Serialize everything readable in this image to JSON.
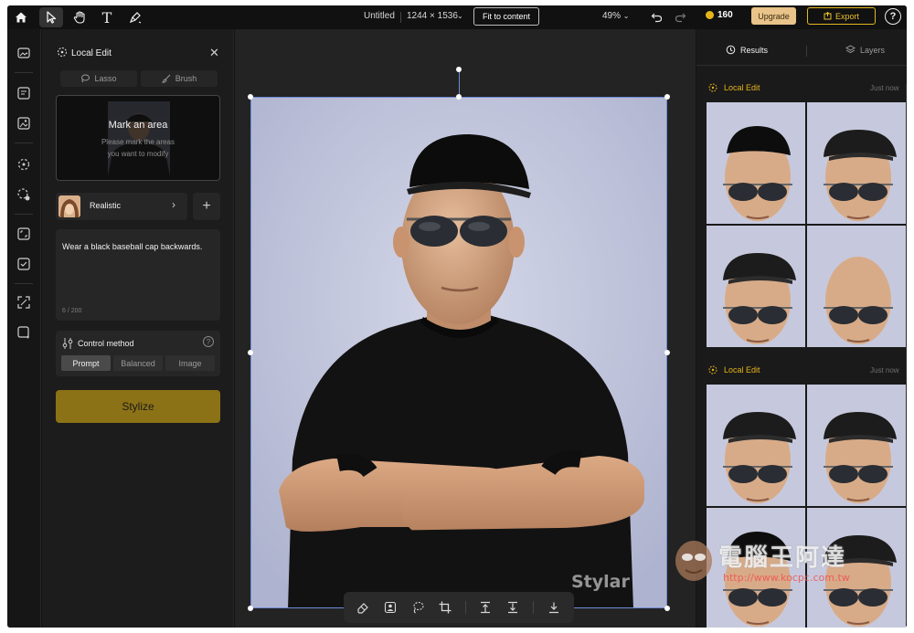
{
  "topbar": {
    "doc_title": "Untitled",
    "doc_size": "1244 × 1536",
    "fit_label": "Fit to content",
    "zoom": "49%",
    "credits": "160",
    "upgrade_label": "Upgrade",
    "export_label": "Export",
    "help_label": "?"
  },
  "panel": {
    "title": "Local Edit",
    "tools": [
      "Lasso",
      "Brush"
    ],
    "mark_title": "Mark an area",
    "mark_sub_1": "Please mark the areas",
    "mark_sub_2": "you want to modify",
    "style_name": "Realistic",
    "prompt_text": "Wear a black baseball cap backwards.",
    "prompt_count": "6 / 200",
    "control_title": "Control method",
    "control_options": [
      "Prompt",
      "Balanced",
      "Image"
    ],
    "control_selected": "Prompt",
    "stylize_label": "Stylize"
  },
  "results": {
    "tabs": [
      "Results",
      "Layers"
    ],
    "groups": [
      {
        "label": "Local Edit",
        "time": "Just now"
      },
      {
        "label": "Local Edit",
        "time": "Just now"
      }
    ]
  },
  "watermarks": {
    "stylar": "Stylar",
    "cn": "電腦王阿達",
    "url": "http://www.kocpc.com.tw"
  },
  "colors": {
    "accent": "#e7b41b",
    "stylize_bg": "#8c7216",
    "selection": "#6f8bd6"
  }
}
